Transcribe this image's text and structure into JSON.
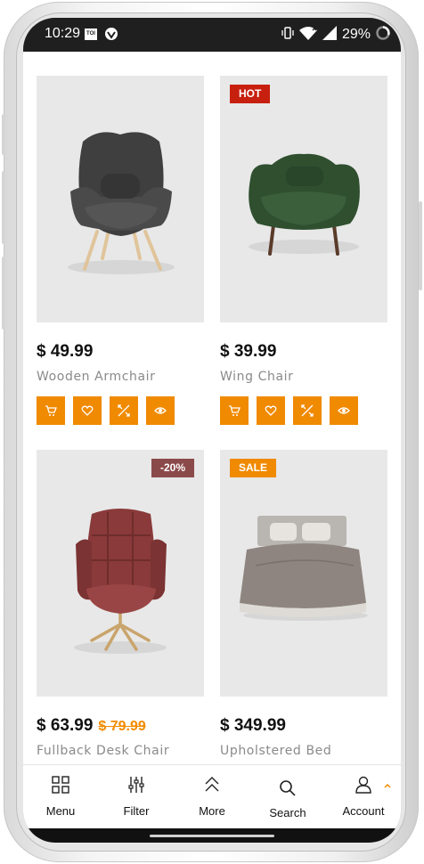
{
  "status_bar": {
    "time": "10:29",
    "app_badge": "TOI",
    "battery": "29%"
  },
  "colors": {
    "accent": "#f08a00",
    "badge_hot": "#c8200f",
    "badge_discount": "#8b4a4a",
    "badge_sale": "#f08a00",
    "old_price": "#f28c00"
  },
  "products": [
    {
      "badge": "",
      "price": "$ 49.99",
      "old_price": "",
      "name": "Wooden Armchair",
      "image_icon": "armchair-image"
    },
    {
      "badge": "HOT",
      "price": "$ 39.99",
      "old_price": "",
      "name": "Wing Chair",
      "image_icon": "wing-chair-image"
    },
    {
      "badge": "-20%",
      "price": "$ 63.99",
      "old_price": "$ 79.99",
      "name": "Fullback Desk Chair",
      "image_icon": "desk-chair-image"
    },
    {
      "badge": "SALE",
      "price": "$ 349.99",
      "old_price": "",
      "name": "Upholstered Bed",
      "image_icon": "bed-image"
    }
  ],
  "product_actions": [
    "cart-icon",
    "heart-icon",
    "compare-icon",
    "eye-icon"
  ],
  "bottom_nav": [
    {
      "label": "Menu",
      "icon": "grid-icon"
    },
    {
      "label": "Filter",
      "icon": "sliders-icon"
    },
    {
      "label": "More",
      "icon": "double-chevron-up-icon"
    },
    {
      "label": "Search",
      "icon": "search-icon"
    },
    {
      "label": "Account",
      "icon": "user-icon"
    }
  ]
}
